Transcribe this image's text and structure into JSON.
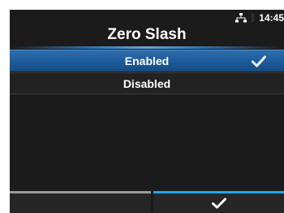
{
  "status_bar": {
    "time": "14:45",
    "network_icon": "network-icon",
    "bluetooth_icon": "bluetooth-icon"
  },
  "header": {
    "title": "Zero Slash"
  },
  "options": [
    {
      "label": "Enabled",
      "selected": true,
      "checked": true
    },
    {
      "label": "Disabled",
      "selected": false,
      "checked": false
    }
  ],
  "footer": {
    "left_button": "",
    "right_button_icon": "checkmark-icon"
  },
  "colors": {
    "background": "#1b1b1b",
    "selection": "#1d5a99",
    "accent": "#29a4e8",
    "text": "#ffffff"
  }
}
